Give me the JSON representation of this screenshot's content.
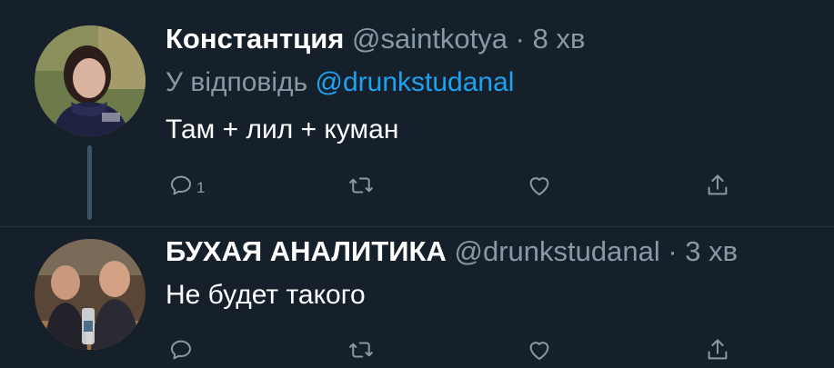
{
  "tweets": [
    {
      "display_name": "Константция",
      "handle": "@saintkotya",
      "separator": "·",
      "time": "8 хв",
      "reply_prefix": "У відповідь",
      "reply_to": "@drunkstudanal",
      "text": "Там + лил + куман",
      "actions": {
        "reply_count": "1",
        "retweet_count": "",
        "like_count": ""
      }
    },
    {
      "display_name": "БУХАЯ АНАЛИТИКА",
      "handle": "@drunkstudanal",
      "separator": "·",
      "time": "3 хв",
      "text": "Не будет такого",
      "actions": {
        "reply_count": "",
        "retweet_count": "",
        "like_count": ""
      }
    }
  ],
  "icons": {
    "reply": "reply-bubble-icon",
    "retweet": "retweet-icon",
    "like": "heart-icon",
    "share": "share-icon"
  },
  "colors": {
    "background": "#15202b",
    "primary_text": "#ffffff",
    "secondary_text": "#8899a6",
    "link": "#1da1f2",
    "thread_line": "#3d5466"
  }
}
